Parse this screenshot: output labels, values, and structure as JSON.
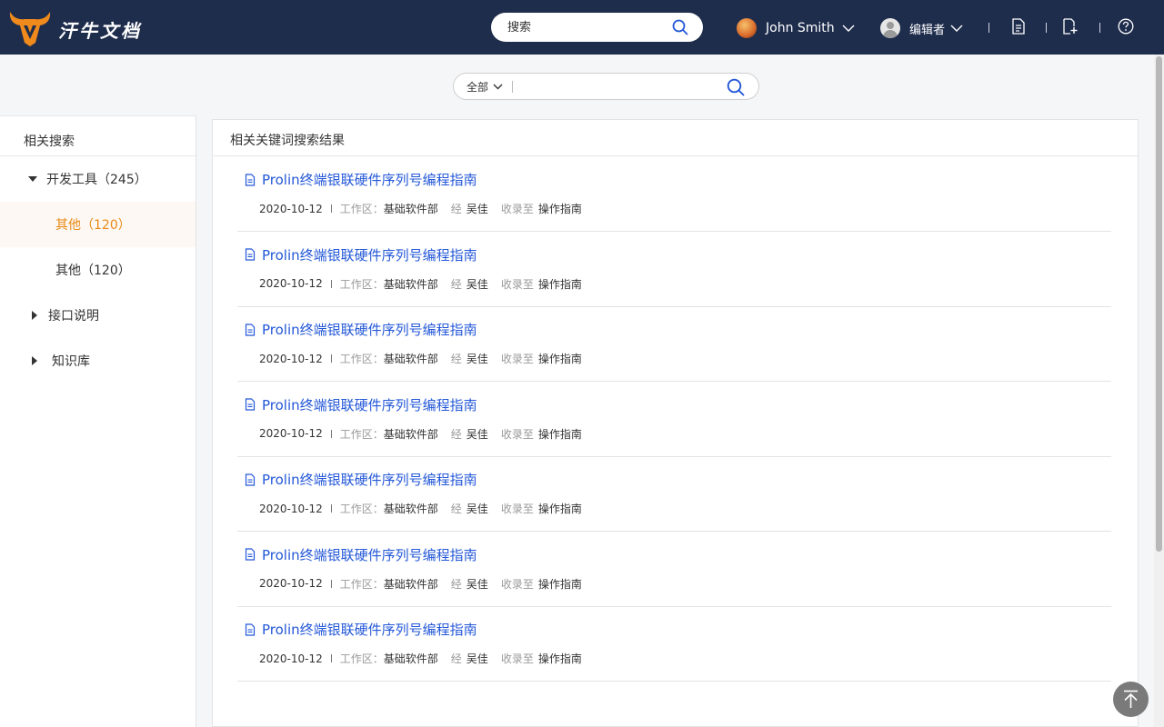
{
  "brand": {
    "name": "汗牛文档"
  },
  "header": {
    "search_placeholder": "搜索",
    "user_name": "John Smith",
    "role_label": "编辑者"
  },
  "sub_search": {
    "scope_label": "全部",
    "value": ""
  },
  "sidebar": {
    "title": "相关搜索",
    "items": [
      {
        "label": "开发工具（245）",
        "expanded": true
      },
      {
        "label": "其他（120）",
        "active": true
      },
      {
        "label": "其他（120）"
      },
      {
        "label": "接口说明",
        "expanded": false
      },
      {
        "label": "知识库",
        "expanded": false
      }
    ]
  },
  "results": {
    "title": "相关关键词搜索结果",
    "workspace_label": "工作区：",
    "by_label": "经",
    "collected_label": "收录至",
    "items": [
      {
        "title": "Prolin终端银联硬件序列号编程指南",
        "date": "2020-10-12",
        "workspace": "基础软件部",
        "author": "吴佳",
        "collection": "操作指南"
      },
      {
        "title": "Prolin终端银联硬件序列号编程指南",
        "date": "2020-10-12",
        "workspace": "基础软件部",
        "author": "吴佳",
        "collection": "操作指南"
      },
      {
        "title": "Prolin终端银联硬件序列号编程指南",
        "date": "2020-10-12",
        "workspace": "基础软件部",
        "author": "吴佳",
        "collection": "操作指南"
      },
      {
        "title": "Prolin终端银联硬件序列号编程指南",
        "date": "2020-10-12",
        "workspace": "基础软件部",
        "author": "吴佳",
        "collection": "操作指南"
      },
      {
        "title": "Prolin终端银联硬件序列号编程指南",
        "date": "2020-10-12",
        "workspace": "基础软件部",
        "author": "吴佳",
        "collection": "操作指南"
      },
      {
        "title": "Prolin终端银联硬件序列号编程指南",
        "date": "2020-10-12",
        "workspace": "基础软件部",
        "author": "吴佳",
        "collection": "操作指南"
      },
      {
        "title": "Prolin终端银联硬件序列号编程指南",
        "date": "2020-10-12",
        "workspace": "基础软件部",
        "author": "吴佳",
        "collection": "操作指南"
      }
    ]
  },
  "icons": {
    "logo": "bull-head-logo",
    "search": "search-icon",
    "document": "document-icon",
    "new_document": "new-document-icon",
    "help": "help-icon",
    "back_to_top": "arrow-up-to-top-icon"
  },
  "colors": {
    "header_bg": "#1f2d4d",
    "link": "#2458d8",
    "active": "#e98a16",
    "logo": "#f08a1c"
  }
}
